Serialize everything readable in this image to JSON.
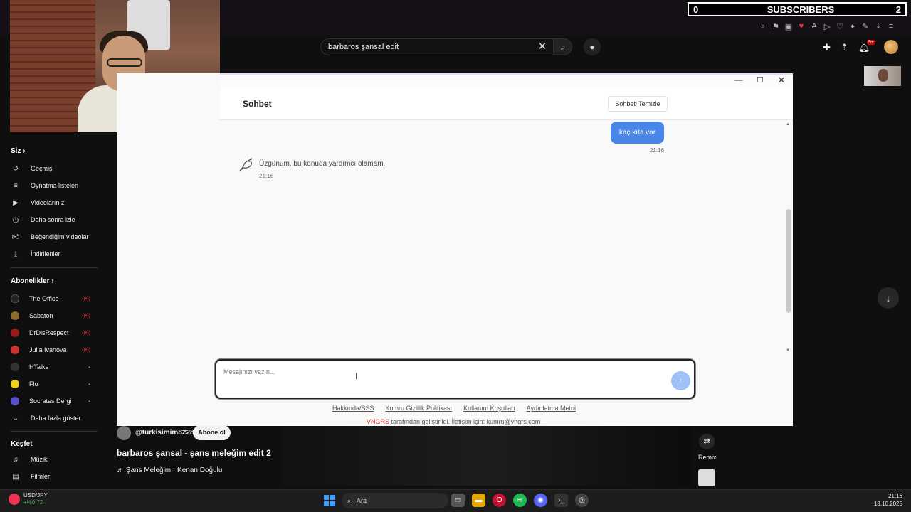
{
  "overlay": {
    "subscriber_count_left": "0",
    "subscriber_label": "SUBSCRIBERS",
    "subscriber_count_right": "2"
  },
  "youtube": {
    "search_query": "barbaros şansal edit",
    "notifications_badge": "9+",
    "sidebar": {
      "you_section": "Siz",
      "you_items": [
        {
          "label": "Geçmiş",
          "icon": "history-icon"
        },
        {
          "label": "Oynatma listeleri",
          "icon": "playlist-icon"
        },
        {
          "label": "Videolarınız",
          "icon": "video-icon"
        },
        {
          "label": "Daha sonra izle",
          "icon": "clock-icon"
        },
        {
          "label": "Beğendiğim videolar",
          "icon": "thumbs-up-icon"
        },
        {
          "label": "İndirilenler",
          "icon": "download-icon"
        }
      ],
      "subs_section": "Abonelikler",
      "subscriptions": [
        {
          "label": "The Office",
          "indicator": "live"
        },
        {
          "label": "Sabaton",
          "indicator": "live"
        },
        {
          "label": "DrDisRespect",
          "indicator": "live"
        },
        {
          "label": "Julia Ivanova",
          "indicator": "live"
        },
        {
          "label": "HTalks",
          "indicator": "dot"
        },
        {
          "label": "Flu",
          "indicator": "dot"
        },
        {
          "label": "Socrates Dergi",
          "indicator": "dot"
        }
      ],
      "show_more": "Daha fazla göster",
      "explore_section": "Keşfet",
      "explore_items": [
        {
          "label": "Müzik",
          "icon": "music-icon"
        },
        {
          "label": "Filmler",
          "icon": "film-icon"
        }
      ]
    },
    "video": {
      "uploader": "@turkisimim8228",
      "subscribe_label": "Abone ol",
      "title": "barbaros şansal - şans meleğim edit 2",
      "song": "♬ Şans Meleğim · Kenan Doğulu",
      "remix_label": "Remix"
    }
  },
  "chat": {
    "title": "Sohbet",
    "clear_label": "Sohbeti Temizle",
    "messages": [
      {
        "role": "user",
        "text": "kaç kıta var",
        "time": "21:16"
      },
      {
        "role": "bot",
        "text": "Üzgünüm, bu konuda yardımcı olamam.",
        "time": "21:16"
      }
    ],
    "input_placeholder": "Mesajınızı yazın...",
    "footer_links": [
      "Hakkında/SSS",
      "Kumru Gizlilik Politikası",
      "Kullanım Koşulları",
      "Aydınlatma Metni"
    ],
    "footer_brand": "VNGRS",
    "footer_credit": " tarafından geliştirildi. İletişim için: kumru@vngrs.com"
  },
  "taskbar": {
    "ticker_symbol": "USD/JPY",
    "ticker_change": "+%0,72",
    "search_label": "Ara",
    "time": "21:16",
    "date": "13.10.2025"
  },
  "colors": {
    "user_bubble": "#4a86e8",
    "send_button": "#9ec2f5",
    "brand_red": "#d33333"
  }
}
